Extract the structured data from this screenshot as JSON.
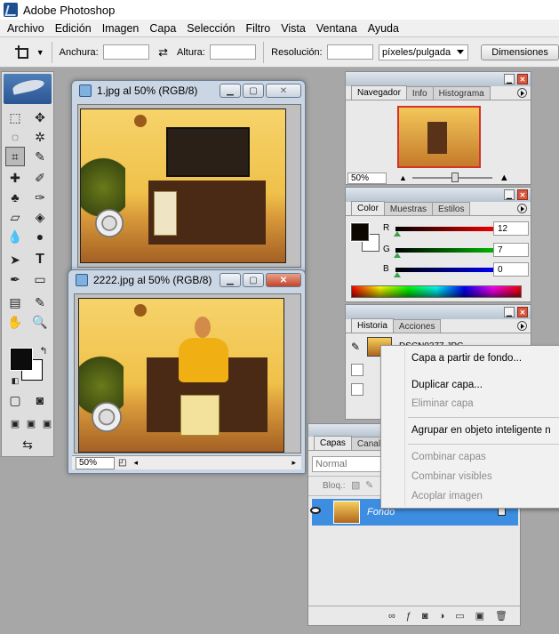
{
  "titlebar": {
    "title": "Adobe Photoshop"
  },
  "menu": [
    "Archivo",
    "Edición",
    "Imagen",
    "Capa",
    "Selección",
    "Filtro",
    "Vista",
    "Ventana",
    "Ayuda"
  ],
  "options": {
    "width_label": "Anchura:",
    "height_label": "Altura:",
    "resolution_label": "Resolución:",
    "units": "píxeles/pulgada",
    "dimensions_button": "Dimensiones"
  },
  "doc1": {
    "title": "1.jpg al 50% (RGB/8)"
  },
  "doc2": {
    "title": "2222.jpg al 50% (RGB/8)",
    "zoom": "50%"
  },
  "navigator": {
    "tabs": [
      "Navegador",
      "Info",
      "Histograma"
    ],
    "zoom": "50%"
  },
  "color": {
    "tabs": [
      "Color",
      "Muestras",
      "Estilos"
    ],
    "r_label": "R",
    "g_label": "G",
    "b_label": "B",
    "r": "12",
    "g": "7",
    "b": "0",
    "foreground": "#0c0700"
  },
  "history": {
    "tabs": [
      "Historia",
      "Acciones"
    ],
    "snapshot": "DSCN0377.JPG"
  },
  "layers": {
    "tabs": [
      "Capas",
      "Canal"
    ],
    "blend_mode": "Normal",
    "lock_label": "Bloq.:",
    "layer_name": "Fondo"
  },
  "context_menu": {
    "items": [
      {
        "label": "Capa a partir de fondo...",
        "enabled": true
      },
      {
        "label": "Duplicar capa...",
        "enabled": true
      },
      {
        "label": "Eliminar capa",
        "enabled": false
      },
      {
        "label": "Agrupar en objeto inteligente n",
        "enabled": true
      },
      {
        "label": "Combinar capas",
        "enabled": false
      },
      {
        "label": "Combinar visibles",
        "enabled": false
      },
      {
        "label": "Acoplar imagen",
        "enabled": false
      }
    ]
  },
  "colors": {
    "accent_selection": "#3d8de0",
    "close_button": "#c2452b"
  }
}
